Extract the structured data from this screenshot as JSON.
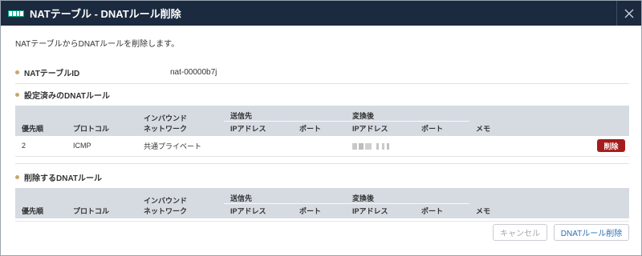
{
  "window": {
    "title": "NATテーブル - DNATルール削除",
    "close_icon": "close-icon",
    "logo_icon": "app-logo-icon"
  },
  "intro": "NATテーブルからDNATルールを削除します。",
  "nat_table": {
    "label": "NATテーブルID",
    "value": "nat-00000b7j"
  },
  "existing": {
    "title": "設定済みのDNATルール",
    "columns": {
      "priority": "優先順",
      "protocol": "プロトコル",
      "inbound_line1": "インバウンド",
      "inbound_line2": "ネットワーク",
      "dest_group": "送信先",
      "dest_ip": "IPアドレス",
      "dest_port": "ポート",
      "trans_group": "変換後",
      "trans_ip": "IPアドレス",
      "trans_port": "ポート",
      "memo": "メモ"
    },
    "rows": [
      {
        "priority": "2",
        "protocol": "ICMP",
        "inbound": "共通プライベート",
        "dest_ip": "",
        "dest_port": "",
        "trans_ip": "",
        "trans_port": "",
        "memo": "",
        "action_label": "削除"
      }
    ]
  },
  "to_delete": {
    "title": "削除するDNATルール",
    "columns": {
      "priority": "優先順",
      "protocol": "プロトコル",
      "inbound_line1": "インバウンド",
      "inbound_line2": "ネットワーク",
      "dest_group": "送信先",
      "dest_ip": "IPアドレス",
      "dest_port": "ポート",
      "trans_group": "変換後",
      "trans_ip": "IPアドレス",
      "trans_port": "ポート",
      "memo": "メモ"
    },
    "rows": []
  },
  "footer": {
    "cancel_label": "キャンセル",
    "submit_label": "DNATルール削除"
  },
  "colors": {
    "titlebar": "#1c2a3f",
    "danger": "#a51c1c",
    "accent": "#2a6fb4",
    "bullet": "#c9a66b"
  }
}
